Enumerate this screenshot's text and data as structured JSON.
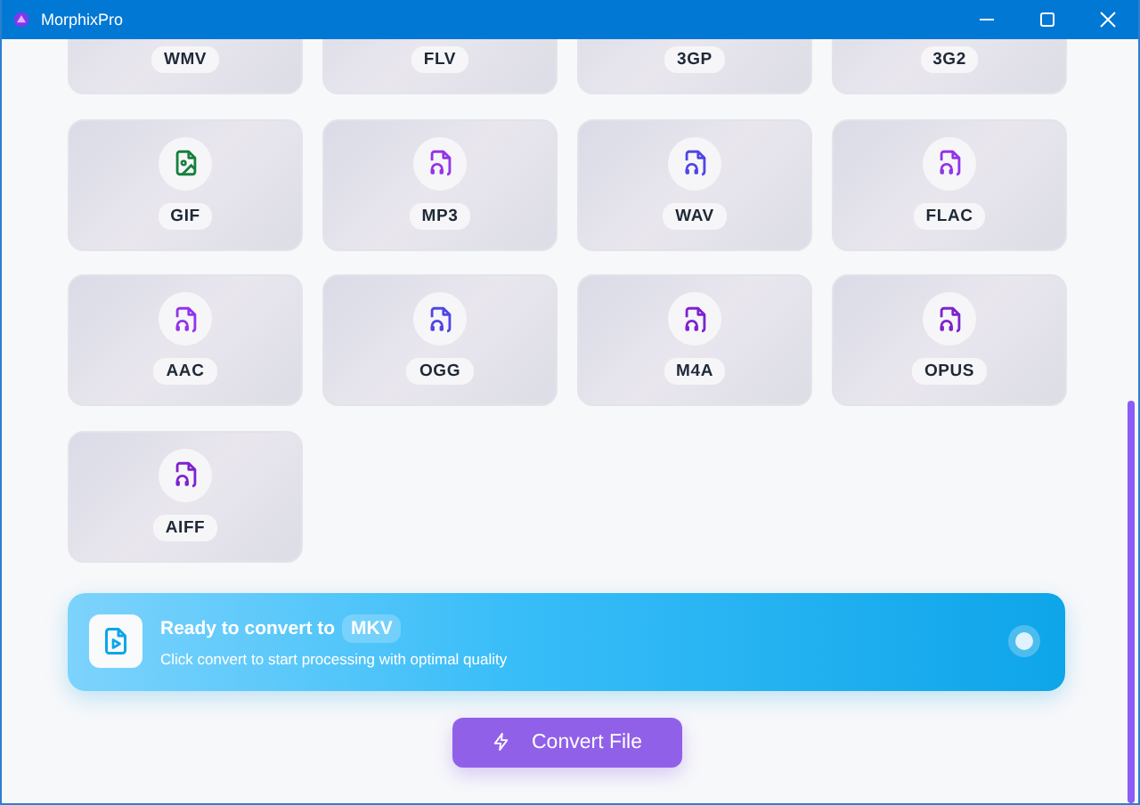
{
  "window": {
    "title": "MorphixPro"
  },
  "formats": [
    {
      "label": "WMV"
    },
    {
      "label": "FLV"
    },
    {
      "label": "3GP"
    },
    {
      "label": "3G2"
    },
    {
      "label": "GIF",
      "icon": {
        "kind": "image",
        "color": "#15803d"
      }
    },
    {
      "label": "MP3",
      "icon": {
        "kind": "audio",
        "color": "#9333ea"
      }
    },
    {
      "label": "WAV",
      "icon": {
        "kind": "audio",
        "color": "#4f46e5"
      }
    },
    {
      "label": "FLAC",
      "icon": {
        "kind": "audio",
        "color": "#9333ea"
      }
    },
    {
      "label": "AAC",
      "icon": {
        "kind": "audio",
        "color": "#9333ea"
      }
    },
    {
      "label": "OGG",
      "icon": {
        "kind": "audio",
        "color": "#4f46e5"
      }
    },
    {
      "label": "M4A",
      "icon": {
        "kind": "audio",
        "color": "#7e22ce"
      }
    },
    {
      "label": "OPUS",
      "icon": {
        "kind": "audio",
        "color": "#7e22ce"
      }
    },
    {
      "label": "AIFF",
      "icon": {
        "kind": "audio",
        "color": "#7e22ce"
      }
    }
  ],
  "banner": {
    "title": "Ready to convert to",
    "target": "MKV",
    "subtitle": "Click convert to start processing with optimal quality"
  },
  "convert_button": {
    "label": "Convert File"
  }
}
